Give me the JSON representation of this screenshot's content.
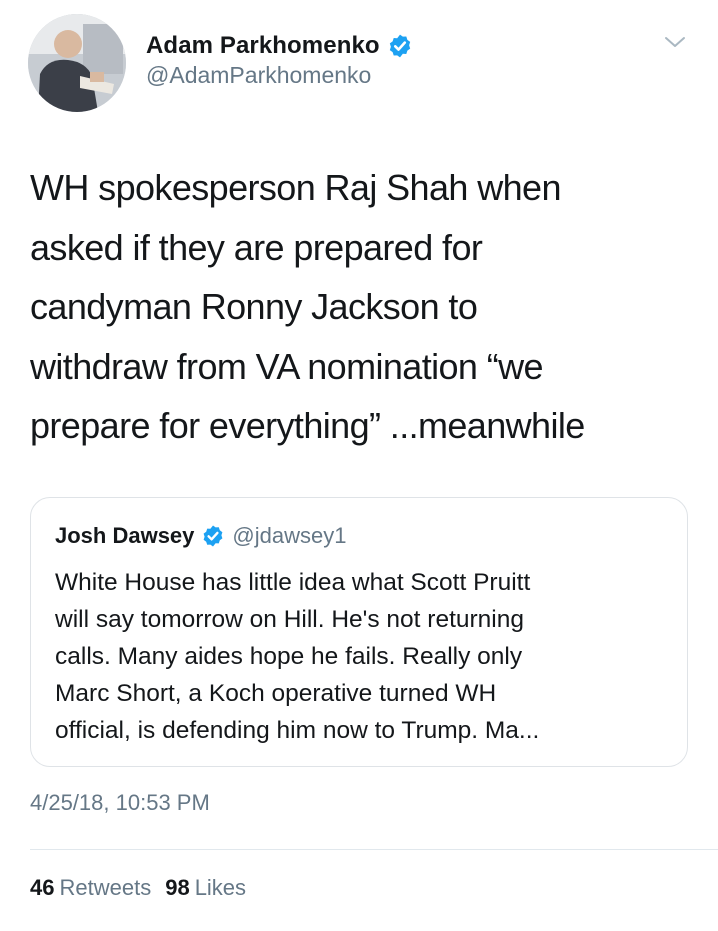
{
  "tweet": {
    "author": {
      "display_name": "Adam Parkhomenko",
      "handle": "@AdamParkhomenko",
      "verified": true
    },
    "text": "WH spokesperson Raj Shah when\nasked if they are prepared for\ncandyman Ronny Jackson to\nwithdraw from VA nomination “we\nprepare for everything” ...meanwhile",
    "quoted": {
      "display_name": "Josh Dawsey",
      "handle": "@jdawsey1",
      "verified": true,
      "text": "White House has little idea what Scott Pruitt\nwill say tomorrow on Hill. He's not returning\ncalls. Many aides hope he fails. Really only\nMarc Short, a Koch operative turned WH\nofficial, is defending him now to Trump. Ma..."
    },
    "timestamp": "4/25/18, 10:53 PM",
    "stats": {
      "retweets_count": "46",
      "retweets_label": "Retweets",
      "likes_count": "98",
      "likes_label": "Likes"
    }
  },
  "icons": {
    "verified": "verified-badge-icon",
    "more": "chevron-down-icon"
  },
  "colors": {
    "verified_blue": "#1da1f2",
    "text_primary": "#14171a",
    "text_secondary": "#657786",
    "border": "#e1e8ed"
  }
}
